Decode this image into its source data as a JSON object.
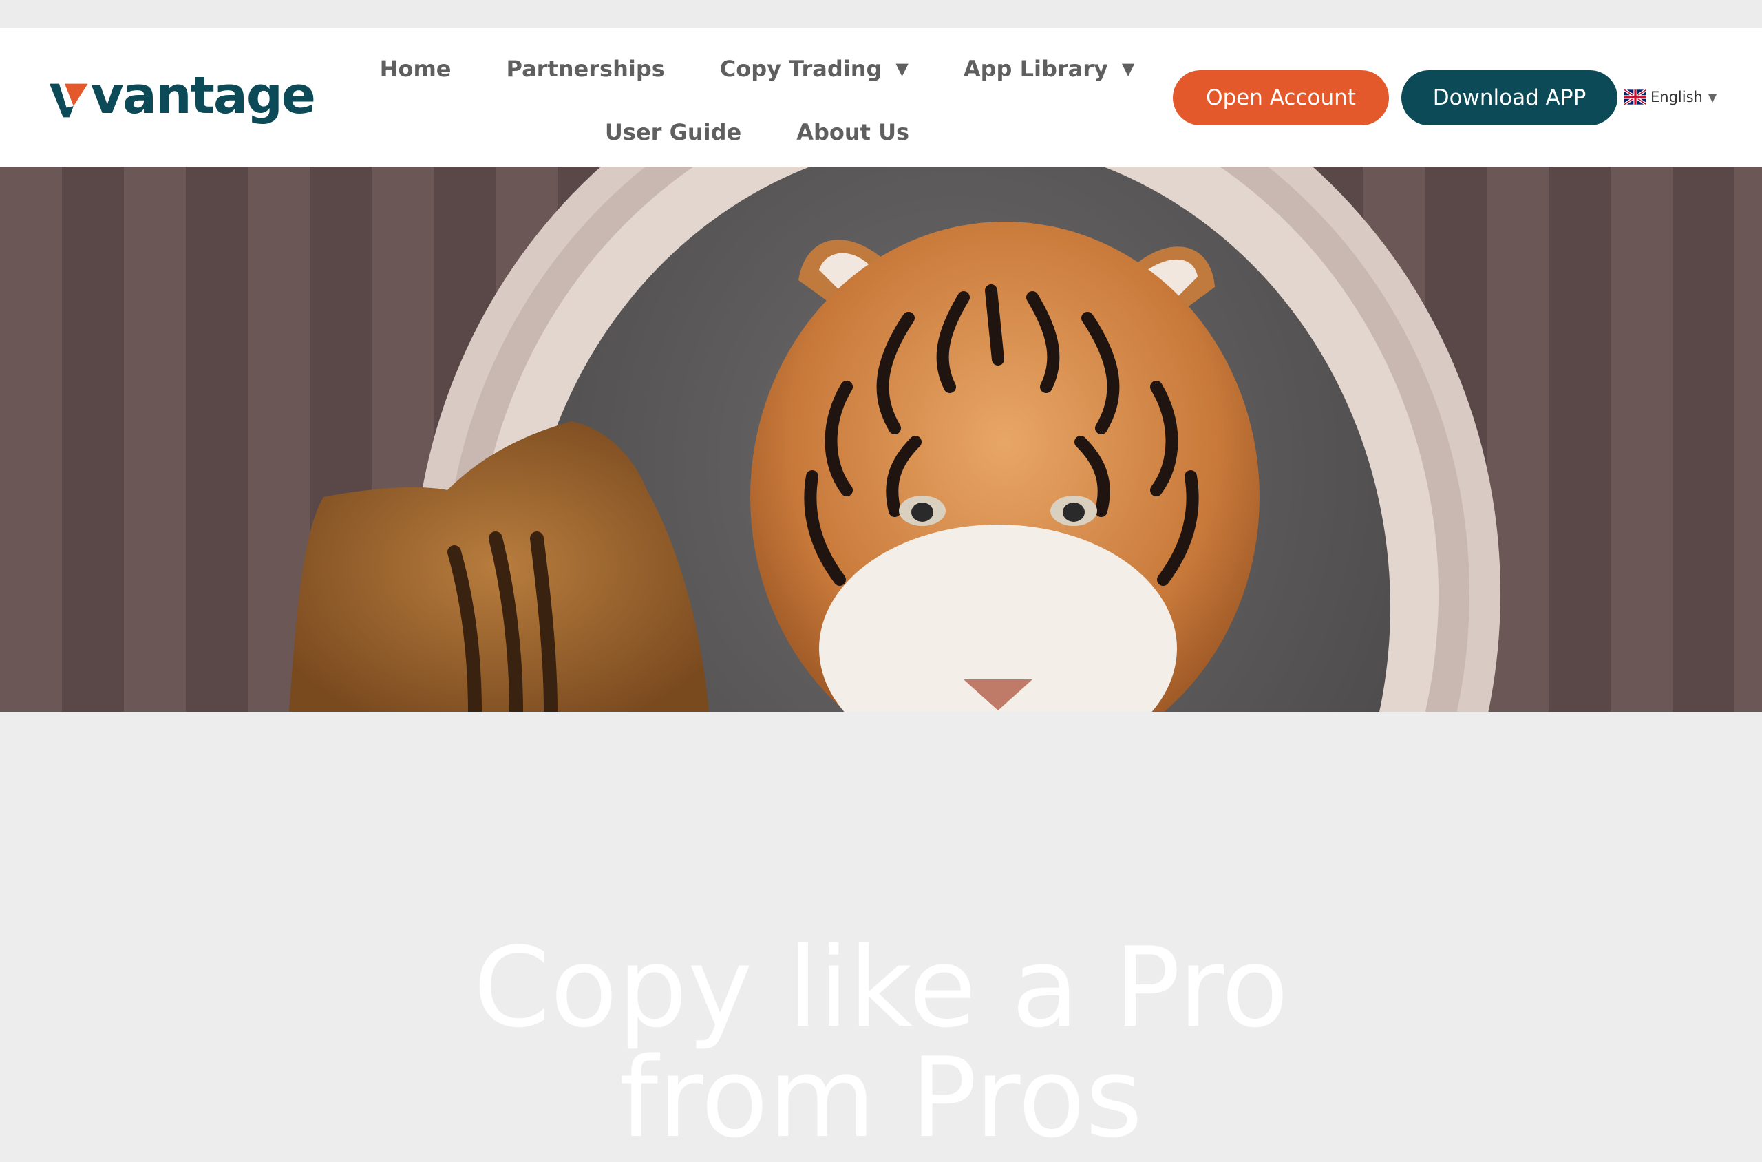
{
  "brand": {
    "name": "vantage",
    "primary_color": "#0c4a57",
    "accent_color": "#e4592c"
  },
  "nav": {
    "row1": [
      {
        "label": "Home",
        "has_dropdown": false
      },
      {
        "label": "Partnerships",
        "has_dropdown": false
      },
      {
        "label": "Copy Trading",
        "has_dropdown": true
      },
      {
        "label": "App Library",
        "has_dropdown": true
      }
    ],
    "row2": [
      {
        "label": "User Guide"
      },
      {
        "label": "About Us"
      }
    ]
  },
  "actions": {
    "open_account": "Open Account",
    "download_app": "Download APP"
  },
  "language": {
    "label": "English",
    "flag_icon": "uk-flag-icon"
  },
  "hero": {
    "line1": "Copy like a Pro",
    "line2": "from Pros"
  }
}
